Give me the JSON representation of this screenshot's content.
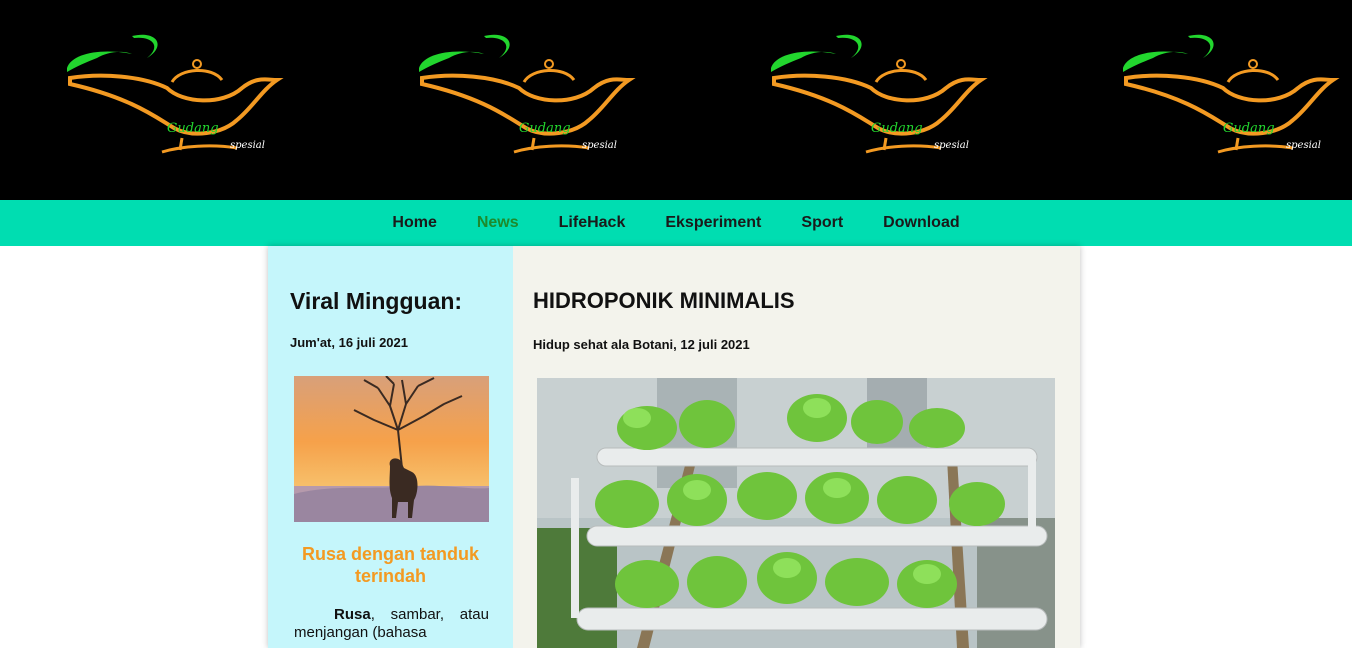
{
  "brand": {
    "logo_text_main": "Gudang",
    "logo_text_sub": "spesial",
    "colors": {
      "green": "#22d62e",
      "orange": "#f39a22",
      "header_bg": "#000000",
      "nav_bg": "#00ddb1"
    }
  },
  "nav": {
    "items": [
      {
        "label": "Home"
      },
      {
        "label": "News"
      },
      {
        "label": "LifeHack"
      },
      {
        "label": "Eksperiment"
      },
      {
        "label": "Sport"
      },
      {
        "label": "Download"
      }
    ],
    "active": "News"
  },
  "sidebar": {
    "title": "Viral Mingguan:",
    "date": "Jum'at, 16 juli 2021",
    "article_title": "Rusa dengan tanduk terindah",
    "article_text_bold": "Rusa",
    "article_text_rest": ", sambar, atau menjangan (bahasa"
  },
  "main": {
    "title": "HIDROPONIK MINIMALIS",
    "subtitle": "Hidup sehat ala Botani, 12 juli 2021"
  }
}
